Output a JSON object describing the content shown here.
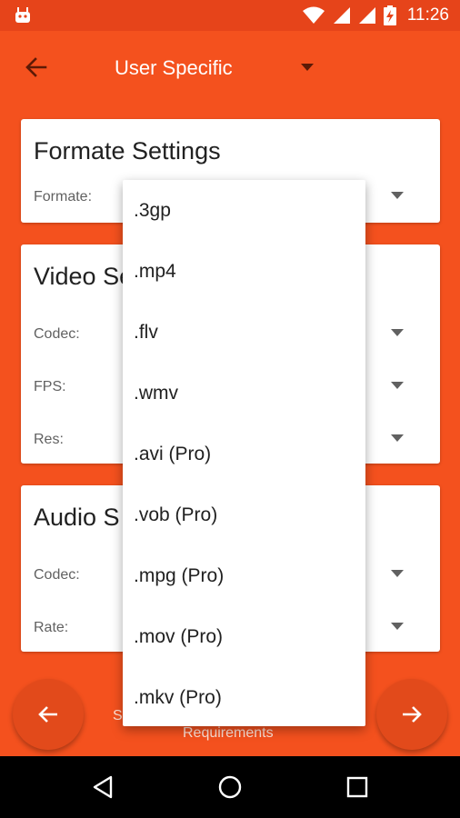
{
  "status_bar": {
    "time": "11:26",
    "icons": [
      "android-icon",
      "wifi-icon",
      "signal-icon",
      "signal-icon",
      "battery-charging-icon"
    ]
  },
  "toolbar": {
    "back_icon": "arrow-left-icon",
    "title": "User Specific",
    "dropdown_icon": "triangle-down-icon"
  },
  "cards": {
    "format": {
      "title": "Formate Settings",
      "rows": [
        {
          "label": "Formate:"
        }
      ]
    },
    "video": {
      "title": "Video Se",
      "rows": [
        {
          "label": "Codec:"
        },
        {
          "label": "FPS:"
        },
        {
          "label": "Res:"
        }
      ]
    },
    "audio": {
      "title": "Audio S",
      "rows": [
        {
          "label": "Codec:"
        },
        {
          "label": "Rate:"
        }
      ]
    }
  },
  "bottom": {
    "back_icon": "arrow-left-icon",
    "next_icon": "arrow-right-icon",
    "partial_text": "S",
    "requirements_text": "Requirements"
  },
  "dropdown": {
    "options": [
      ".3gp",
      ".mp4",
      ".flv",
      ".wmv",
      ".avi (Pro)",
      ".vob (Pro)",
      ".mpg (Pro)",
      ".mov (Pro)",
      ".mkv (Pro)"
    ]
  },
  "nav_bar": {
    "icons": [
      "back-triangle-icon",
      "home-circle-icon",
      "recents-square-icon"
    ]
  },
  "colors": {
    "background": "#F4511E",
    "status_bar": "#E6441A",
    "fab": "#E24A1B",
    "card": "#FFFFFF"
  }
}
